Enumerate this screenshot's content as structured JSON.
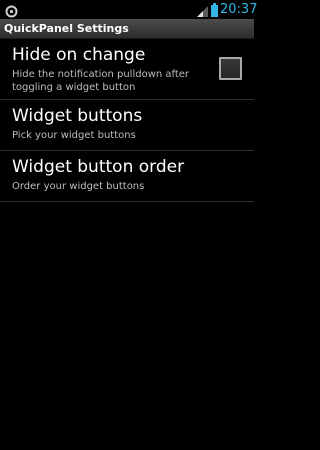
{
  "status_bar": {
    "time": "20:37",
    "icons": [
      "notification-ring-icon",
      "signal-icon",
      "battery-icon"
    ]
  },
  "app_bar": {
    "title": "QuickPanel Settings"
  },
  "preferences": [
    {
      "title": "Hide on change",
      "summary": "Hide the notification pulldown after toggling a widget button",
      "checked": false
    },
    {
      "title": "Widget buttons",
      "summary": "Pick your widget buttons"
    },
    {
      "title": "Widget button order",
      "summary": "Order your widget buttons"
    }
  ],
  "colors": {
    "background": "#000000",
    "accent": "#33b5e5",
    "summary_text": "#bdbdbd",
    "divider": "#2e2e2e"
  }
}
